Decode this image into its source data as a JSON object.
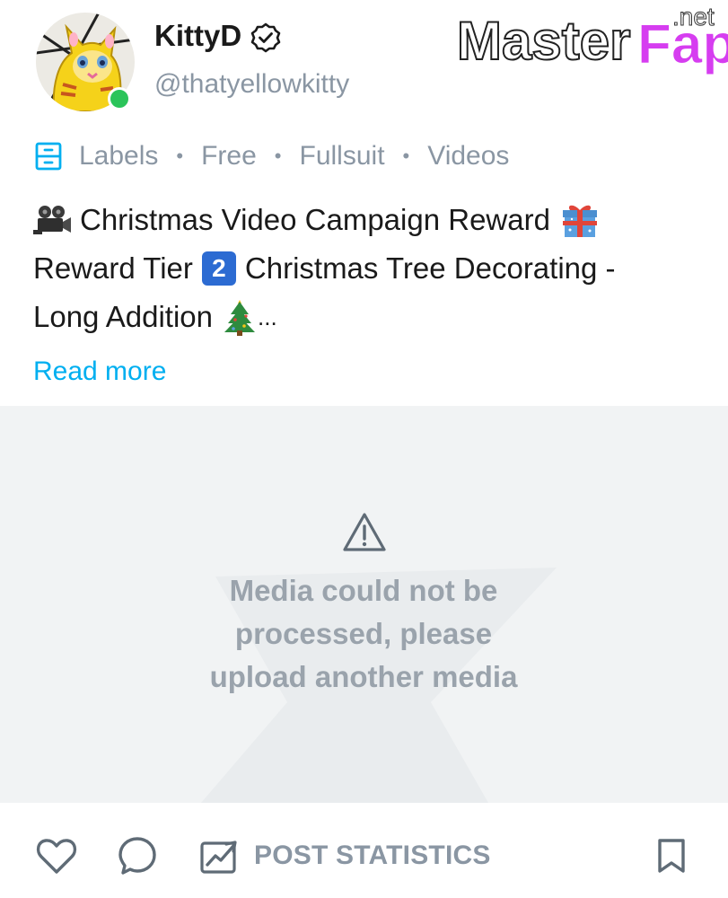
{
  "header": {
    "display_name": "KittyD",
    "handle": "@thatyellowkitty",
    "verified": true,
    "online": true,
    "online_color": "#2bc45a"
  },
  "watermark": {
    "main": "Master",
    "accent": "Fap",
    "suffix": ".net",
    "accent_color": "#d63df0"
  },
  "labels": {
    "icon": "labels-icon",
    "items": [
      "Labels",
      "Free",
      "Fullsuit",
      "Videos"
    ],
    "separator": "•"
  },
  "post": {
    "line1": {
      "lead_emoji": "movie-camera-emoji",
      "text": "Christmas Video Campaign Reward",
      "trail_emoji": "gift-emoji"
    },
    "line2": {
      "before": "Reward Tier",
      "keycap": "2",
      "after": "Christmas Tree Decorating -"
    },
    "line3": {
      "text": "Long Addition",
      "trail_emoji": "christmas-tree-emoji",
      "ellipsis": "..."
    },
    "read_more": "Read more",
    "link_color": "#00aff0"
  },
  "media": {
    "icon": "warning-icon",
    "error_lines": [
      "Media could not be",
      "processed, please",
      "upload another media"
    ]
  },
  "actions": {
    "like_icon": "heart-icon",
    "comment_icon": "comment-icon",
    "stats_icon": "chart-icon",
    "stats_label": "POST STATISTICS",
    "bookmark_icon": "bookmark-icon"
  }
}
